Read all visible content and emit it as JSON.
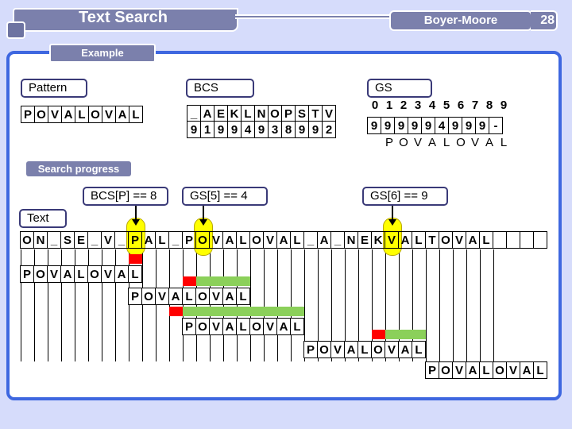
{
  "header": {
    "title": "Text Search",
    "topic": "Boyer-Moore",
    "page_number": "28"
  },
  "example": {
    "section_label": "Example",
    "pattern_label": "Pattern",
    "pattern": [
      "P",
      "O",
      "V",
      "A",
      "L",
      "O",
      "V",
      "A",
      "L"
    ],
    "bcs_label": "BCS",
    "bcs_chars": [
      "_",
      "A",
      "E",
      "K",
      "L",
      "N",
      "O",
      "P",
      "S",
      "T",
      "V"
    ],
    "bcs_values": [
      "9",
      "1",
      "9",
      "9",
      "4",
      "9",
      "3",
      "8",
      "9",
      "9",
      "2"
    ],
    "gs_label": "GS",
    "gs_indices": [
      "0",
      "1",
      "2",
      "3",
      "4",
      "5",
      "6",
      "7",
      "8",
      "9"
    ],
    "gs_values": [
      "9",
      "9",
      "9",
      "9",
      "9",
      "4",
      "9",
      "9",
      "9",
      "-"
    ],
    "gs_pattern": [
      "P",
      "O",
      "V",
      "A",
      "L",
      "O",
      "V",
      "A",
      "L"
    ]
  },
  "progress": {
    "section_label": "Search progress",
    "text_label": "Text",
    "annotations": [
      {
        "label": "BCS[P] == 8",
        "column": 8
      },
      {
        "label": "GS[5] == 4",
        "column": 13
      },
      {
        "label": "GS[6] == 9",
        "column": 27
      }
    ],
    "text": [
      "O",
      "N",
      "_",
      "S",
      "E",
      "_",
      "V",
      "_",
      "P",
      "A",
      "L",
      "_",
      "P",
      "O",
      "V",
      "A",
      "L",
      "O",
      "V",
      "A",
      "L",
      "_",
      "A",
      "_",
      "N",
      "E",
      "K",
      "V",
      "A",
      "L",
      "T",
      "O",
      "V",
      "A",
      "L",
      "",
      "",
      "",
      ""
    ],
    "attempts": [
      {
        "offset": 0,
        "mismatch_col": 8,
        "match_cols": []
      },
      {
        "offset": 8,
        "mismatch_col": 12,
        "match_cols": [
          13,
          14,
          15,
          16
        ]
      },
      {
        "offset": 12,
        "mismatch_col": 11,
        "match_cols": [
          12,
          13,
          14,
          15,
          16,
          17,
          18,
          19,
          20
        ]
      },
      {
        "offset": 21,
        "mismatch_col": 26,
        "match_cols": [
          27,
          28,
          29
        ]
      },
      {
        "offset": 30,
        "mismatch_col": null,
        "match_cols": []
      }
    ],
    "colors": {
      "mismatch": "#ff0000",
      "match": "#8bd05a",
      "highlight": "#ffff00"
    }
  }
}
